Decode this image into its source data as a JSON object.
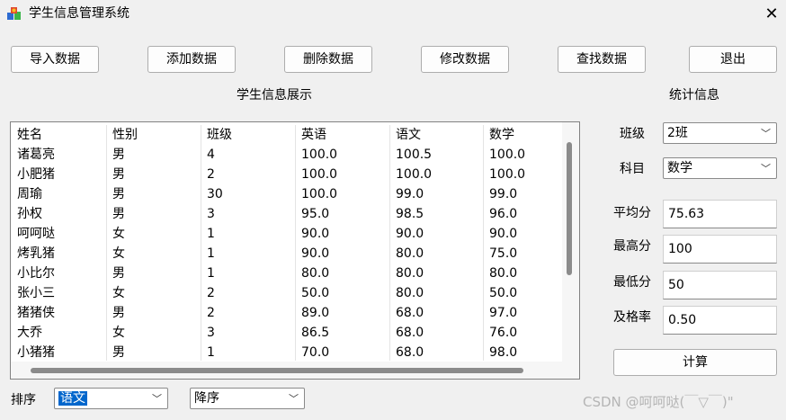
{
  "window": {
    "title": "学生信息管理系统",
    "close_glyph": "✕"
  },
  "toolbar": {
    "import": "导入数据",
    "add": "添加数据",
    "delete": "删除数据",
    "modify": "修改数据",
    "find": "查找数据",
    "exit": "退出"
  },
  "table": {
    "title": "学生信息展示",
    "headers": [
      "姓名",
      "性别",
      "班级",
      "英语",
      "语文",
      "数学"
    ],
    "rows": [
      [
        "诸葛亮",
        "男",
        "4",
        "100.0",
        "100.5",
        "100.0"
      ],
      [
        "小肥猪",
        "男",
        "2",
        "100.0",
        "100.0",
        "100.0"
      ],
      [
        "周瑜",
        "男",
        "30",
        "100.0",
        "99.0",
        "99.0"
      ],
      [
        "孙权",
        "男",
        "3",
        "95.0",
        "98.5",
        "96.0"
      ],
      [
        "呵呵哒",
        "女",
        "1",
        "90.0",
        "90.0",
        "90.0"
      ],
      [
        "烤乳猪",
        "女",
        "1",
        "90.0",
        "80.0",
        "75.0"
      ],
      [
        "小比尔",
        "男",
        "1",
        "80.0",
        "80.0",
        "80.0"
      ],
      [
        "张小三",
        "女",
        "2",
        "50.0",
        "80.0",
        "50.0"
      ],
      [
        "猪猪侠",
        "男",
        "2",
        "89.0",
        "68.0",
        "97.0"
      ],
      [
        "大乔",
        "女",
        "3",
        "86.5",
        "68.0",
        "76.0"
      ],
      [
        "小猪猪",
        "男",
        "1",
        "70.0",
        "68.0",
        "98.0"
      ]
    ]
  },
  "stats": {
    "title": "统计信息",
    "class_label": "班级",
    "class_value": "2班",
    "subject_label": "科目",
    "subject_value": "数学",
    "avg_label": "平均分",
    "avg_value": "75.63",
    "max_label": "最高分",
    "max_value": "100",
    "min_label": "最低分",
    "min_value": "50",
    "pass_label": "及格率",
    "pass_value": "0.50",
    "calc": "计算"
  },
  "sort": {
    "label": "排序",
    "field_value": "语文",
    "order_value": "降序"
  },
  "watermark": "CSDN @呵呵哒(￣▽￣)\"",
  "colors": {
    "accent": "#0066cc",
    "scroll_thumb": "#8b8b8b"
  }
}
